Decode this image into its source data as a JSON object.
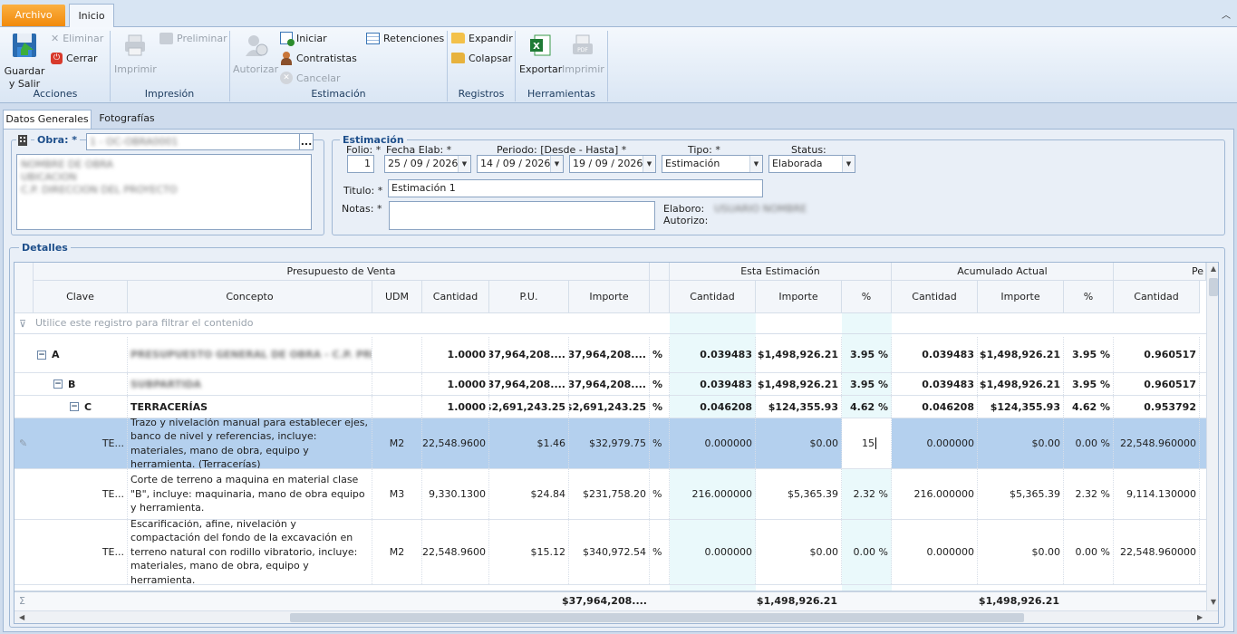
{
  "ribbon": {
    "tabs": {
      "archivo": "Archivo",
      "inicio": "Inicio"
    },
    "acciones": {
      "guardar_line1": "Guardar",
      "guardar_line2": "y Salir",
      "eliminar": "Eliminar",
      "cerrar": "Cerrar",
      "group": "Acciones"
    },
    "impresion": {
      "imprimir": "Imprimir",
      "preliminar": "Preliminar",
      "group": "Impresión"
    },
    "estimacion": {
      "autorizar": "Autorizar",
      "iniciar": "Iniciar",
      "contratistas": "Contratistas",
      "cancelar": "Cancelar",
      "retenciones": "Retenciones",
      "group": "Estimación"
    },
    "registros": {
      "expandir": "Expandir",
      "colapsar": "Colapsar",
      "group": "Registros"
    },
    "herramientas": {
      "exportar": "Exportar",
      "imprimir": "Imprimir",
      "group": "Herramientas"
    }
  },
  "page_tabs": {
    "datos": "Datos Generales",
    "fotos": "Fotografías"
  },
  "obra": {
    "label": "Obra: *",
    "value": "1 - OC-OBRA0001",
    "details": [
      "NOMBRE DE OBRA",
      "UBICACION",
      "C.P. DIRECCION DEL PROYECTO"
    ],
    "button": "..."
  },
  "estimacion": {
    "title": "Estimación",
    "folio_label": "Folio: *",
    "folio": "1",
    "fecha_label": "Fecha Elab: *",
    "fecha": "25 / 09 / 2026",
    "periodo_label": "Periodo:  [Desde - Hasta] *",
    "desde": "14 / 09 / 2026",
    "hasta": "19 / 09 / 2026",
    "tipo_label": "Tipo: *",
    "tipo": "Estimación",
    "status_label": "Status:",
    "status": "Elaborada",
    "titulo_label": "Titulo: *",
    "titulo": "Estimación 1",
    "notas_label": "Notas: *",
    "notas": "",
    "elaboro_label": "Elaboro:",
    "elaboro": "USUARIO NOMBRE",
    "autorizo_label": "Autorizo:"
  },
  "detalles": {
    "title": "Detalles",
    "band_headers": {
      "presupuesto": "Presupuesto de Venta",
      "esta": "Esta Estimación",
      "acumulado": "Acumulado Actual",
      "pendiente": "Pe"
    },
    "columns": [
      "Clave",
      "Concepto",
      "UDM",
      "Cantidad",
      "P.U.",
      "Importe",
      "Cantidad",
      "Importe",
      "%",
      "Cantidad",
      "Importe",
      "%",
      "Cantidad"
    ],
    "filter_placeholder": "Utilice este registro para filtrar el contenido",
    "rows": [
      {
        "clave": "A",
        "concepto": "PRESUPUESTO GENERAL DE OBRA - C.P. PRIMERA ETAPA",
        "udm": "",
        "cantidad": "1.0000",
        "pu": "$37,964,208....",
        "importe": "$37,964,208....",
        "pct_sym": "%",
        "e_cant": "0.039483",
        "e_imp": "$1,498,926.21",
        "e_pct": "3.95 %",
        "a_cant": "0.039483",
        "a_imp": "$1,498,926.21",
        "a_pct": "3.95 %",
        "p_cant": "0.960517"
      },
      {
        "clave": "B",
        "concepto": "SUBPARTIDA",
        "udm": "",
        "cantidad": "1.0000",
        "pu": "$37,964,208....",
        "importe": "$37,964,208....",
        "pct_sym": "%",
        "e_cant": "0.039483",
        "e_imp": "$1,498,926.21",
        "e_pct": "3.95 %",
        "a_cant": "0.039483",
        "a_imp": "$1,498,926.21",
        "a_pct": "3.95 %",
        "p_cant": "0.960517"
      },
      {
        "clave": "C",
        "concepto": "TERRACERÍAS",
        "udm": "",
        "cantidad": "1.0000",
        "pu": "$2,691,243.25",
        "importe": "$2,691,243.25",
        "pct_sym": "%",
        "e_cant": "0.046208",
        "e_imp": "$124,355.93",
        "e_pct": "4.62 %",
        "a_cant": "0.046208",
        "a_imp": "$124,355.93",
        "a_pct": "4.62 %",
        "p_cant": "0.953792"
      },
      {
        "clave": "TE...",
        "concepto": "Trazo y nivelación manual para establecer ejes, banco de nivel y referencias, incluye: materiales, mano de obra, equipo y herramienta. (Terracerías)",
        "udm": "M2",
        "cantidad": "22,548.9600",
        "pu": "$1.46",
        "importe": "$32,979.75",
        "pct_sym": "%",
        "e_cant": "0.000000",
        "e_imp": "$0.00",
        "e_pct": "15",
        "a_cant": "0.000000",
        "a_imp": "$0.00",
        "a_pct": "0.00 %",
        "p_cant": "22,548.960000"
      },
      {
        "clave": "TE...",
        "concepto": "Corte de terreno a maquina en material clase \"B\", incluye: maquinaria, mano de obra equipo y herramienta.",
        "udm": "M3",
        "cantidad": "9,330.1300",
        "pu": "$24.84",
        "importe": "$231,758.20",
        "pct_sym": "%",
        "e_cant": "216.000000",
        "e_imp": "$5,365.39",
        "e_pct": "2.32 %",
        "a_cant": "216.000000",
        "a_imp": "$5,365.39",
        "a_pct": "2.32 %",
        "p_cant": "9,114.130000"
      },
      {
        "clave": "TE...",
        "concepto": "Escarificación, afine, nivelación y compactación del fondo de la excavación en terreno natural con rodillo vibratorio, incluye: materiales, mano de obra, equipo y herramienta.",
        "udm": "M2",
        "cantidad": "22,548.9600",
        "pu": "$15.12",
        "importe": "$340,972.54",
        "pct_sym": "%",
        "e_cant": "0.000000",
        "e_imp": "$0.00",
        "e_pct": "0.00 %",
        "a_cant": "0.000000",
        "a_imp": "$0.00",
        "a_pct": "0.00 %",
        "p_cant": "22,548.960000"
      }
    ],
    "totals": {
      "importe": "$37,964,208....",
      "e_imp": "$1,498,926.21",
      "a_imp": "$1,498,926.21"
    }
  }
}
